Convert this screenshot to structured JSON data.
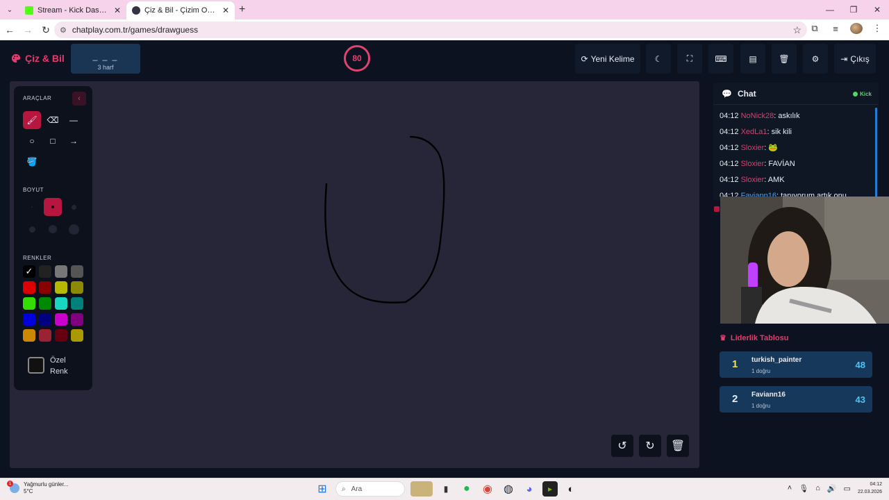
{
  "browser": {
    "tabs": [
      {
        "title": "Stream - Kick Dashboard",
        "active": false,
        "favicon_color": "#53fc18"
      },
      {
        "title": "Çiz & Bil - Çizim Oyunu",
        "active": true,
        "favicon_color": "#333344"
      }
    ],
    "url": "chatplay.com.tr/games/drawguess"
  },
  "header": {
    "logo": "Çiz & Bil",
    "word_dashes": "_ _ _",
    "word_hint": "3 harf",
    "timer": "80",
    "new_word": "Yeni Kelime",
    "exit": "Çıkış"
  },
  "toolbox": {
    "tools_title": "ARAÇLAR",
    "size_title": "BOYUT",
    "colors_title": "RENKLER",
    "custom_color_line1": "Özel",
    "custom_color_line2": "Renk",
    "colors": [
      [
        "#000000",
        "#222222",
        "#777777",
        "#555555"
      ],
      [
        "#dd0000",
        "#880000",
        "#b6b800",
        "#8c8a00"
      ],
      [
        "#33dd00",
        "#008800",
        "#19d6c0",
        "#00807a"
      ],
      [
        "#0000dd",
        "#000080",
        "#cc00cc",
        "#800080"
      ],
      [
        "#cc8800",
        "#992233",
        "#660011",
        "#aa9900"
      ]
    ]
  },
  "chat": {
    "title": "Chat",
    "platform": "Kick",
    "messages": [
      {
        "time": "04:12",
        "user": "NoNick28",
        "text": ": askılık"
      },
      {
        "time": "04:12",
        "user": "XedLa1",
        "text": ": sik kili"
      },
      {
        "time": "04:12",
        "user": "Sloxier",
        "text": ": 🐸"
      },
      {
        "time": "04:12",
        "user": "Sloxier",
        "text": ": FAVİAN"
      },
      {
        "time": "04:12",
        "user": "Sloxier",
        "text": ": AMK"
      },
      {
        "time": "04:12",
        "user": "Faviann16",
        "text": ": tanıyorum artık onu"
      }
    ]
  },
  "leaderboard": {
    "title": "Liderlik Tablosu",
    "entries": [
      {
        "rank": "1",
        "name": "turkish_painter",
        "sub": "1 doğru",
        "score": "48",
        "rank_color": "#f5e14a"
      },
      {
        "rank": "2",
        "name": "Faviann16",
        "sub": "1 doğru",
        "score": "43",
        "rank_color": "#e8ecf4"
      }
    ]
  },
  "taskbar": {
    "weather_title": "Yağmurlu günler...",
    "weather_temp": "5°C",
    "weather_badge": "1",
    "search": "Ara",
    "time": "04:12",
    "date": "22.03.2026"
  }
}
